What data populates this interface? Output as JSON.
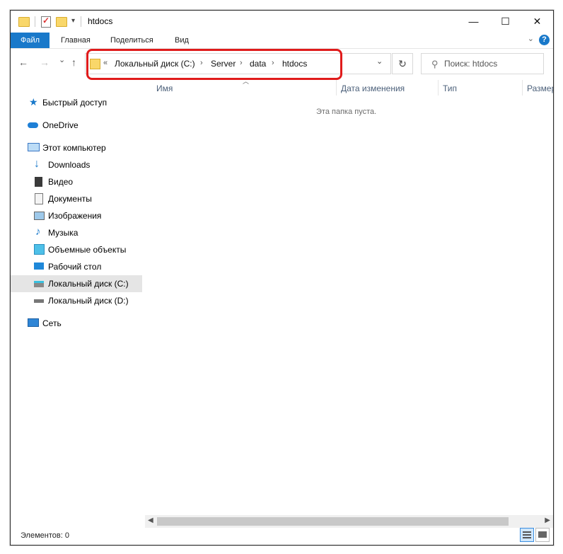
{
  "window": {
    "title": "htdocs",
    "min_glyph": "—",
    "max_glyph": "☐",
    "close_glyph": "✕"
  },
  "ribbon": {
    "tabs": [
      "Файл",
      "Главная",
      "Поделиться",
      "Вид"
    ],
    "help_glyph": "?"
  },
  "nav": {
    "back_glyph": "←",
    "forward_glyph": "→",
    "recent_glyph": "⌄",
    "up_glyph": "↑",
    "overflow": "«",
    "breadcrumb": [
      "Локальный диск (C:)",
      "Server",
      "data",
      "htdocs"
    ],
    "separator": "›",
    "dropdown_glyph": "⌄",
    "refresh_glyph": "↻",
    "search_placeholder": "Поиск: htdocs",
    "search_glyph": "⚲"
  },
  "sidebar": {
    "items": [
      {
        "label": "Быстрый доступ",
        "icon": "star-icon"
      },
      {
        "label": "OneDrive",
        "icon": "cloud-icon"
      },
      {
        "label": "Этот компьютер",
        "icon": "computer-icon"
      },
      {
        "label": "Downloads",
        "icon": "download-icon"
      },
      {
        "label": "Видео",
        "icon": "video-icon"
      },
      {
        "label": "Документы",
        "icon": "document-icon"
      },
      {
        "label": "Изображения",
        "icon": "image-icon"
      },
      {
        "label": "Музыка",
        "icon": "music-icon"
      },
      {
        "label": "Объемные объекты",
        "icon": "cube-icon"
      },
      {
        "label": "Рабочий стол",
        "icon": "desktop-icon"
      },
      {
        "label": "Локальный диск (C:)",
        "icon": "drive-c-icon",
        "selected": true
      },
      {
        "label": "Локальный диск (D:)",
        "icon": "drive-d-icon"
      },
      {
        "label": "Сеть",
        "icon": "network-icon"
      }
    ]
  },
  "content": {
    "columns": [
      "Имя",
      "Дата изменения",
      "Тип",
      "Размер"
    ],
    "empty_message": "Эта папка пуста."
  },
  "status": {
    "items_text": "Элементов: 0"
  },
  "colors": {
    "accent": "#1979ca",
    "highlight_border": "#e01b1b",
    "selected_bg": "#e5e5e5",
    "folder": "#f9d76a"
  }
}
